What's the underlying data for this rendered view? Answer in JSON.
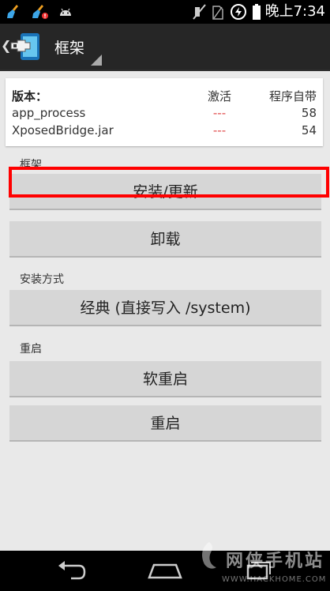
{
  "status_bar": {
    "time": "晚上7:34",
    "icons": [
      "broom-icon",
      "broom-alert-icon",
      "android-icon",
      "mute-icon",
      "sim-icon",
      "data-saver-icon",
      "battery-icon"
    ]
  },
  "action_bar": {
    "title": "框架",
    "back_glyph": "❮",
    "app_icon": "xposed-app-icon"
  },
  "versions": {
    "header": {
      "name": "版本：",
      "active": "激活",
      "own": "程序自带"
    },
    "rows": [
      {
        "name": "app_process",
        "active": "---",
        "own": "58"
      },
      {
        "name": "XposedBridge.jar",
        "active": "---",
        "own": "54"
      }
    ]
  },
  "framework": {
    "label": "框架",
    "install_button": "安装/更新",
    "uninstall_button": "卸载"
  },
  "install_method": {
    "label": "安装方式",
    "selected": "经典 (直接写入 /system)"
  },
  "restart": {
    "label": "重启",
    "soft_reboot_button": "软重启",
    "reboot_button": "重启"
  },
  "navigation": {
    "icons": [
      "back-icon",
      "home-icon",
      "recents-icon"
    ]
  },
  "watermark": {
    "text": "网侠手机站",
    "url": "WWW.HACKHOME.COM"
  },
  "colors": {
    "highlight": "#ff0000",
    "inactive": "#e04848",
    "button": "#d6d6d6"
  }
}
